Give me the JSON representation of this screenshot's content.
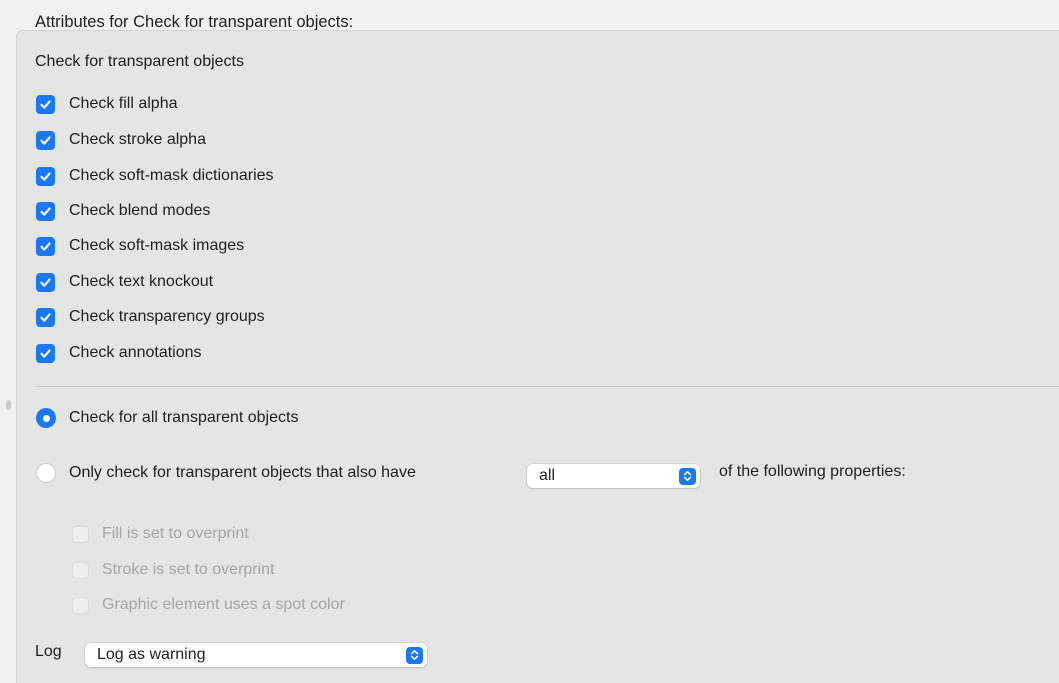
{
  "header": {
    "title": "Attributes for Check for transparent objects:"
  },
  "group": {
    "title": "Check for transparent objects"
  },
  "checks": [
    {
      "label": "Check fill alpha",
      "checked": true
    },
    {
      "label": "Check stroke alpha",
      "checked": true
    },
    {
      "label": "Check soft-mask dictionaries",
      "checked": true
    },
    {
      "label": "Check blend modes",
      "checked": true
    },
    {
      "label": "Check soft-mask images",
      "checked": true
    },
    {
      "label": "Check text knockout",
      "checked": true
    },
    {
      "label": "Check transparency groups",
      "checked": true
    },
    {
      "label": "Check annotations",
      "checked": true
    }
  ],
  "scope": {
    "all_label": "Check for all transparent objects",
    "only_label": "Only check for transparent objects that also have",
    "selected": "all",
    "match_select_value": "all",
    "suffix": "of the following properties:"
  },
  "properties": [
    {
      "label": "Fill is set to overprint",
      "checked": false,
      "enabled": false
    },
    {
      "label": "Stroke is set to overprint",
      "checked": false,
      "enabled": false
    },
    {
      "label": "Graphic element uses a spot color",
      "checked": false,
      "enabled": false
    }
  ],
  "log": {
    "label": "Log",
    "value": "Log as warning"
  },
  "colors": {
    "accent": "#1a78f4",
    "panel_bg": "#e5e5e5",
    "window_bg": "#f1f1f1",
    "disabled_text": "#a6a6a6"
  },
  "icons": {
    "checkmark": "checkmark-icon",
    "select_arrows": "updown-chevron-icon"
  }
}
